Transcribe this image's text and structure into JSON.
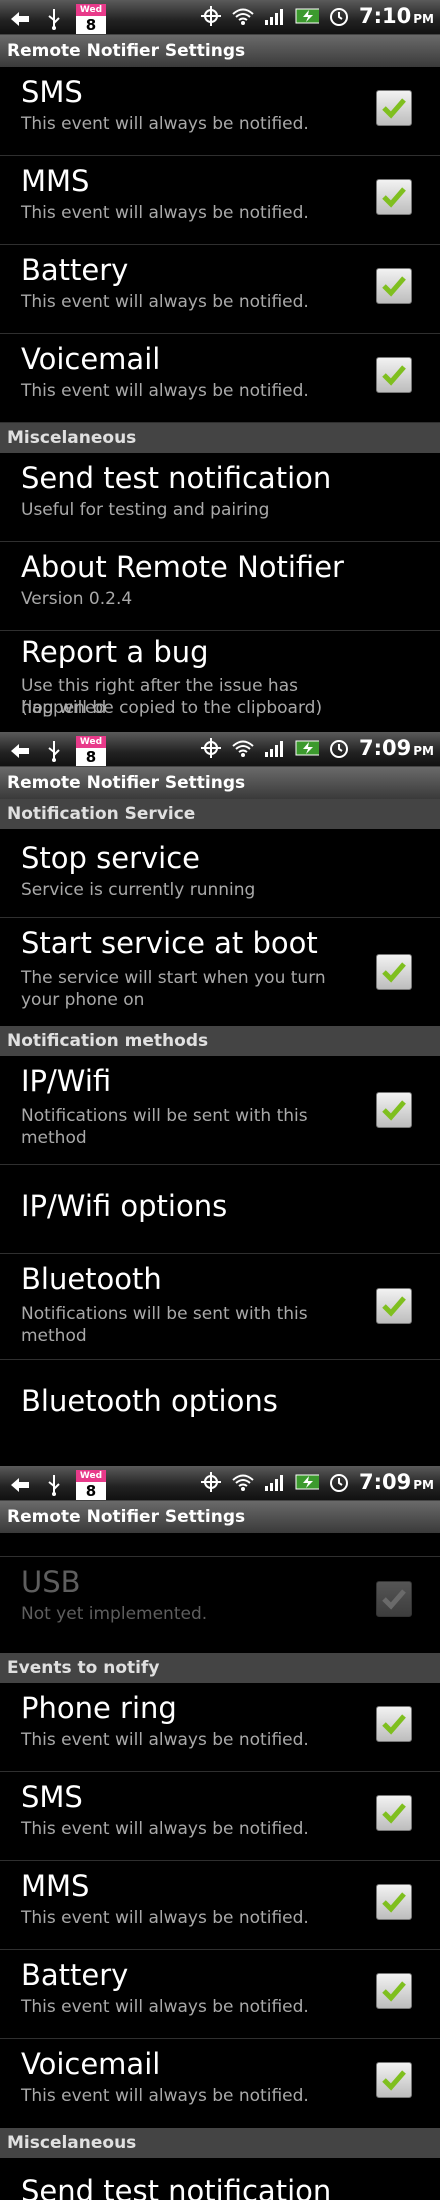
{
  "screens": [
    {
      "status": {
        "date_label": "Wed",
        "date_num": "8",
        "time": "7:10",
        "ampm": "PM"
      },
      "title": "Remote Notifier Settings",
      "rows": {
        "sms": {
          "title": "SMS",
          "summary": "This event will always be notified.",
          "checked": true
        },
        "mms": {
          "title": "MMS",
          "summary": "This event will always be notified.",
          "checked": true
        },
        "battery": {
          "title": "Battery",
          "summary": "This event will always be notified.",
          "checked": true
        },
        "voicemail": {
          "title": "Voicemail",
          "summary": "This event will always be notified.",
          "checked": true
        }
      },
      "misc_header": "Miscelaneous",
      "send_test": {
        "title": "Send test notification",
        "summary": "Useful for testing and pairing"
      },
      "about": {
        "title": "About Remote Notifier",
        "summary": "Version 0.2.4"
      },
      "report": {
        "title": "Report a bug",
        "summary_1": "Use this right after the issue has happened",
        "summary_2": "(log will be copied to the clipboard)"
      }
    },
    {
      "status": {
        "date_label": "Wed",
        "date_num": "8",
        "time": "7:09",
        "ampm": "PM"
      },
      "title": "Remote Notifier Settings",
      "service_header": "Notification Service",
      "stop": {
        "title": "Stop service",
        "summary": "Service is currently running"
      },
      "boot": {
        "title": "Start service at boot",
        "summary_1": "The service will start when you turn",
        "summary_2": "your phone on",
        "checked": true
      },
      "methods_header": "Notification methods",
      "ipwifi": {
        "title": "IP/Wifi",
        "summary_1": "Notifications will be sent with this",
        "summary_2": "method",
        "checked": true
      },
      "ipwifi_options": "IP/Wifi options",
      "bluetooth": {
        "title": "Bluetooth",
        "summary_1": "Notifications will be sent with this",
        "summary_2": "method",
        "checked": true
      },
      "bluetooth_options": "Bluetooth options"
    },
    {
      "status": {
        "date_label": "Wed",
        "date_num": "8",
        "time": "7:09",
        "ampm": "PM"
      },
      "title": "Remote Notifier Settings",
      "usb": {
        "title": "USB",
        "summary": "Not yet implemented.",
        "checked": true,
        "enabled": false
      },
      "events_header": "Events to notify",
      "rows": {
        "phone_ring": {
          "title": "Phone ring",
          "summary": "This event will always be notified.",
          "checked": true
        },
        "sms": {
          "title": "SMS",
          "summary": "This event will always be notified.",
          "checked": true
        },
        "mms": {
          "title": "MMS",
          "summary": "This event will always be notified.",
          "checked": true
        },
        "battery": {
          "title": "Battery",
          "summary": "This event will always be notified.",
          "checked": true
        },
        "voicemail": {
          "title": "Voicemail",
          "summary": "This event will always be notified.",
          "checked": true
        }
      },
      "misc_header": "Miscelaneous",
      "send_test_partial": "Send test notification"
    }
  ],
  "colors": {
    "accent_check": "#7fbf1f",
    "header_bg": "#444444",
    "summary_text": "#a9a9a9"
  }
}
